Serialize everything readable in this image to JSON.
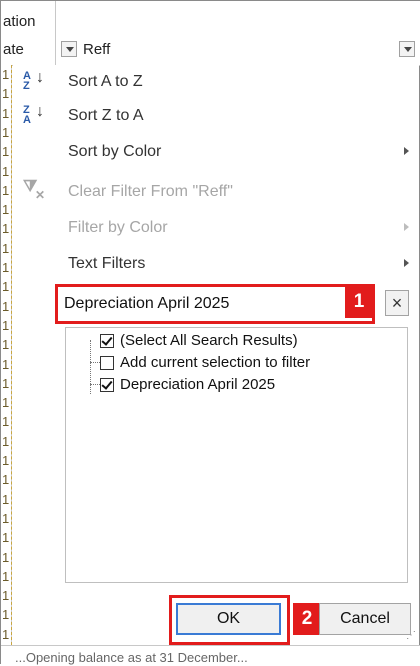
{
  "header": {
    "col_left_line1": "ation",
    "col_left_line2": "ate",
    "col_right_title": "Reff"
  },
  "menu": {
    "sort_asc": "Sort A to Z",
    "sort_desc": "Sort Z to A",
    "sort_color": "Sort by Color",
    "clear_filter": "Clear Filter From \"Reff\"",
    "filter_color": "Filter by Color",
    "text_filters": "Text Filters"
  },
  "search": {
    "value": "Depreciation April 2025",
    "clear_symbol": "×"
  },
  "list": {
    "items": [
      {
        "label": "(Select All Search Results)",
        "checked": true
      },
      {
        "label": "Add current selection to filter",
        "checked": false
      },
      {
        "label": "Depreciation April 2025",
        "checked": true
      }
    ]
  },
  "buttons": {
    "ok": "OK",
    "cancel": "Cancel"
  },
  "annotations": {
    "step1": "1",
    "step2": "2"
  },
  "sheet": {
    "row_marker": "1",
    "bottom_text": "...Opening balance as at 31 December..."
  },
  "colors": {
    "highlight_red": "#e21c1c",
    "ok_border_blue": "#3a7bd5"
  }
}
